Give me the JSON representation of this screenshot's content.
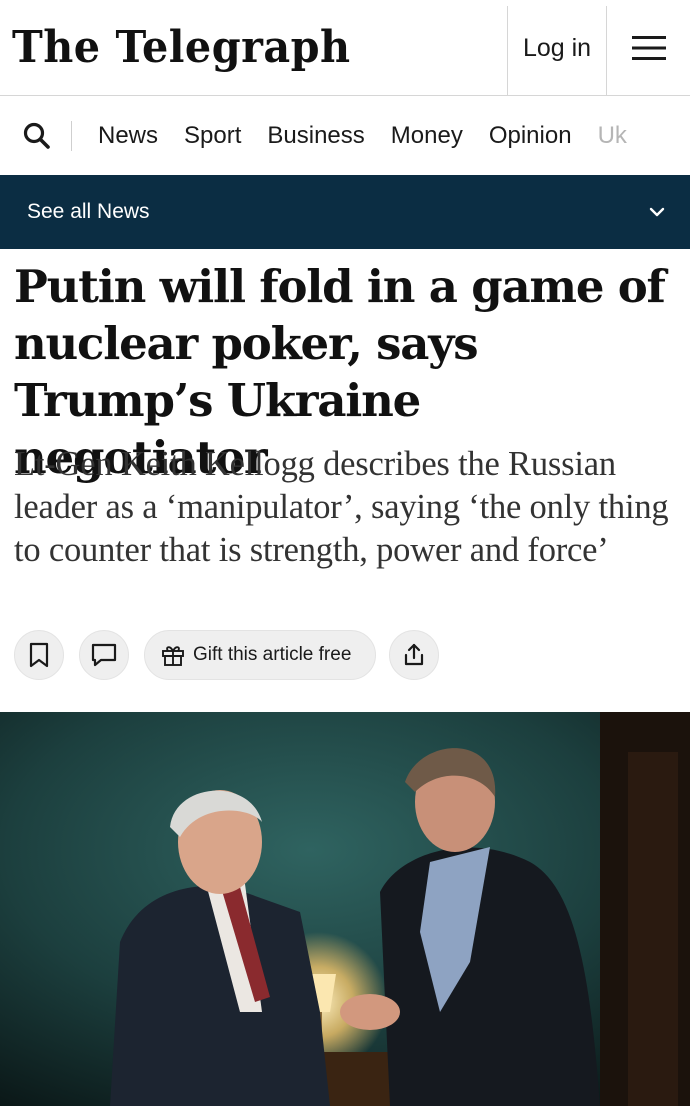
{
  "header": {
    "logo": "The Telegraph",
    "login_label": "Log in",
    "menu_icon": "hamburger-menu-icon"
  },
  "nav": {
    "search_icon": "search-icon",
    "items": [
      "News",
      "Sport",
      "Business",
      "Money",
      "Opinion",
      "Uk"
    ]
  },
  "section_bar": {
    "label": "See all News",
    "icon": "chevron-down-icon",
    "background": "#0b2d43"
  },
  "article": {
    "headline": "Putin will fold in a game of nuclear poker, says Trump’s Ukraine negotiator",
    "standfirst": "Lt-Gen Keith Kellogg describes the Russian leader as a ‘manipulator’, saying ‘the only thing to counter that is strength, power and force’",
    "actions": {
      "bookmark_icon": "bookmark-icon",
      "comment_icon": "comment-icon",
      "gift_label": "Gift this article free",
      "gift_icon": "gift-icon",
      "share_icon": "share-icon"
    }
  }
}
